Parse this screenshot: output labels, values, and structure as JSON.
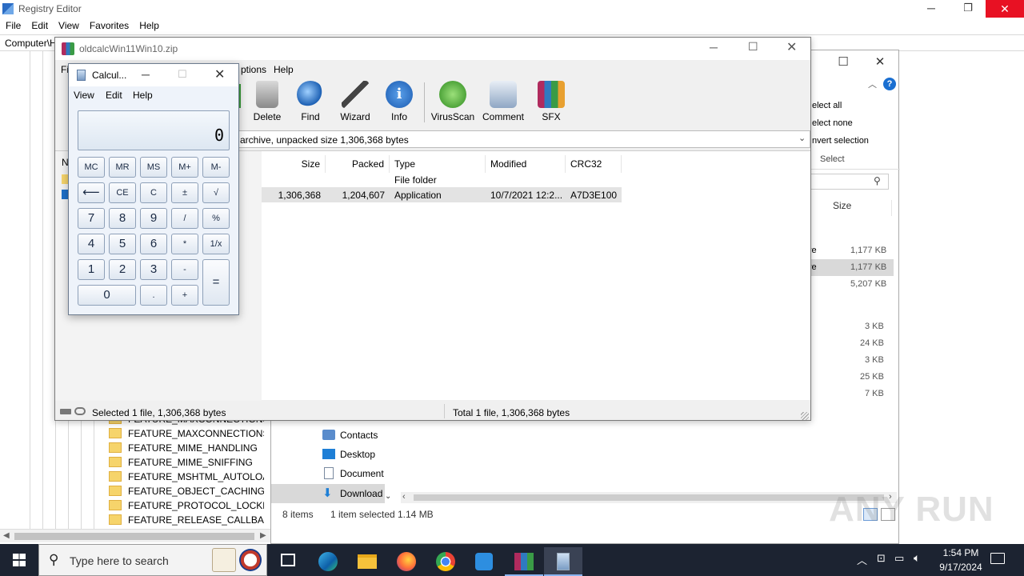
{
  "registry": {
    "title": "Registry Editor",
    "menu": [
      "File",
      "Edit",
      "View",
      "Favorites",
      "Help"
    ],
    "address": "Computer\\H",
    "tree_items": [
      "FEATURE_MAXCONNECTIONSPE",
      "FEATURE_MAXCONNECTIONSPE",
      "FEATURE_MIME_HANDLING",
      "FEATURE_MIME_SNIFFING",
      "FEATURE_MSHTML_AUTOLOAD_",
      "FEATURE_OBJECT_CACHING",
      "FEATURE_PROTOCOL_LOCKDOW",
      "FEATURE_RELEASE_CALLBACK_O"
    ]
  },
  "explorer": {
    "ribbon": {
      "select_all": "elect all",
      "select_none": "elect none",
      "invert": "nvert selection",
      "group": "Select"
    },
    "col_size": "Size",
    "right_rows": [
      {
        "t": "ve",
        "s": "1,177 KB"
      },
      {
        "t": "ve",
        "s": "1,177 KB"
      },
      {
        "t": "",
        "s": "5,207 KB"
      },
      {
        "t": "",
        "s": "3 KB"
      },
      {
        "t": "",
        "s": "24 KB"
      },
      {
        "t": "",
        "s": "3 KB"
      },
      {
        "t": "",
        "s": "25 KB"
      },
      {
        "t": "",
        "s": "7 KB"
      }
    ],
    "nav": [
      "Contacts",
      "Desktop",
      "Document",
      "Download"
    ],
    "status": {
      "items": "8 items",
      "selected": "1 item selected",
      "size": "1.14 MB"
    }
  },
  "winrar": {
    "title": "oldcalcWin11Win10.zip",
    "menu_partial": [
      "Fi",
      "ptions",
      "Help"
    ],
    "tools": [
      "Delete",
      "Find",
      "Wizard",
      "Info",
      "VirusScan",
      "Comment",
      "SFX"
    ],
    "path_text": "archive, unpacked size 1,306,368 bytes",
    "columns": [
      "Size",
      "Packed",
      "Type",
      "Modified",
      "CRC32"
    ],
    "n_col": "N",
    "rows": [
      {
        "size": "",
        "packed": "",
        "type": "File folder",
        "modified": "",
        "crc": ""
      },
      {
        "size": "1,306,368",
        "packed": "1,204,607",
        "type": "Application",
        "modified": "10/7/2021 12:2...",
        "crc": "A7D3E100"
      }
    ],
    "status_left": "Selected 1 file, 1,306,368 bytes",
    "status_right": "Total 1 file, 1,306,368 bytes"
  },
  "calculator": {
    "title": "Calcul...",
    "menu": [
      "View",
      "Edit",
      "Help"
    ],
    "display": "0",
    "buttons": {
      "mc": "MC",
      "mr": "MR",
      "ms": "MS",
      "mplus": "M+",
      "mminus": "M-",
      "back": "⟵",
      "ce": "CE",
      "c": "C",
      "pm": "±",
      "sqrt": "√",
      "n7": "7",
      "n8": "8",
      "n9": "9",
      "div": "/",
      "pct": "%",
      "n4": "4",
      "n5": "5",
      "n6": "6",
      "mul": "*",
      "inv": "1/x",
      "n1": "1",
      "n2": "2",
      "n3": "3",
      "sub": "-",
      "eq": "=",
      "n0": "0",
      "dot": ".",
      "add": "+"
    }
  },
  "taskbar": {
    "search_placeholder": "Type here to search",
    "time": "1:54 PM",
    "date": "9/17/2024"
  },
  "watermark": "ANY RUN"
}
